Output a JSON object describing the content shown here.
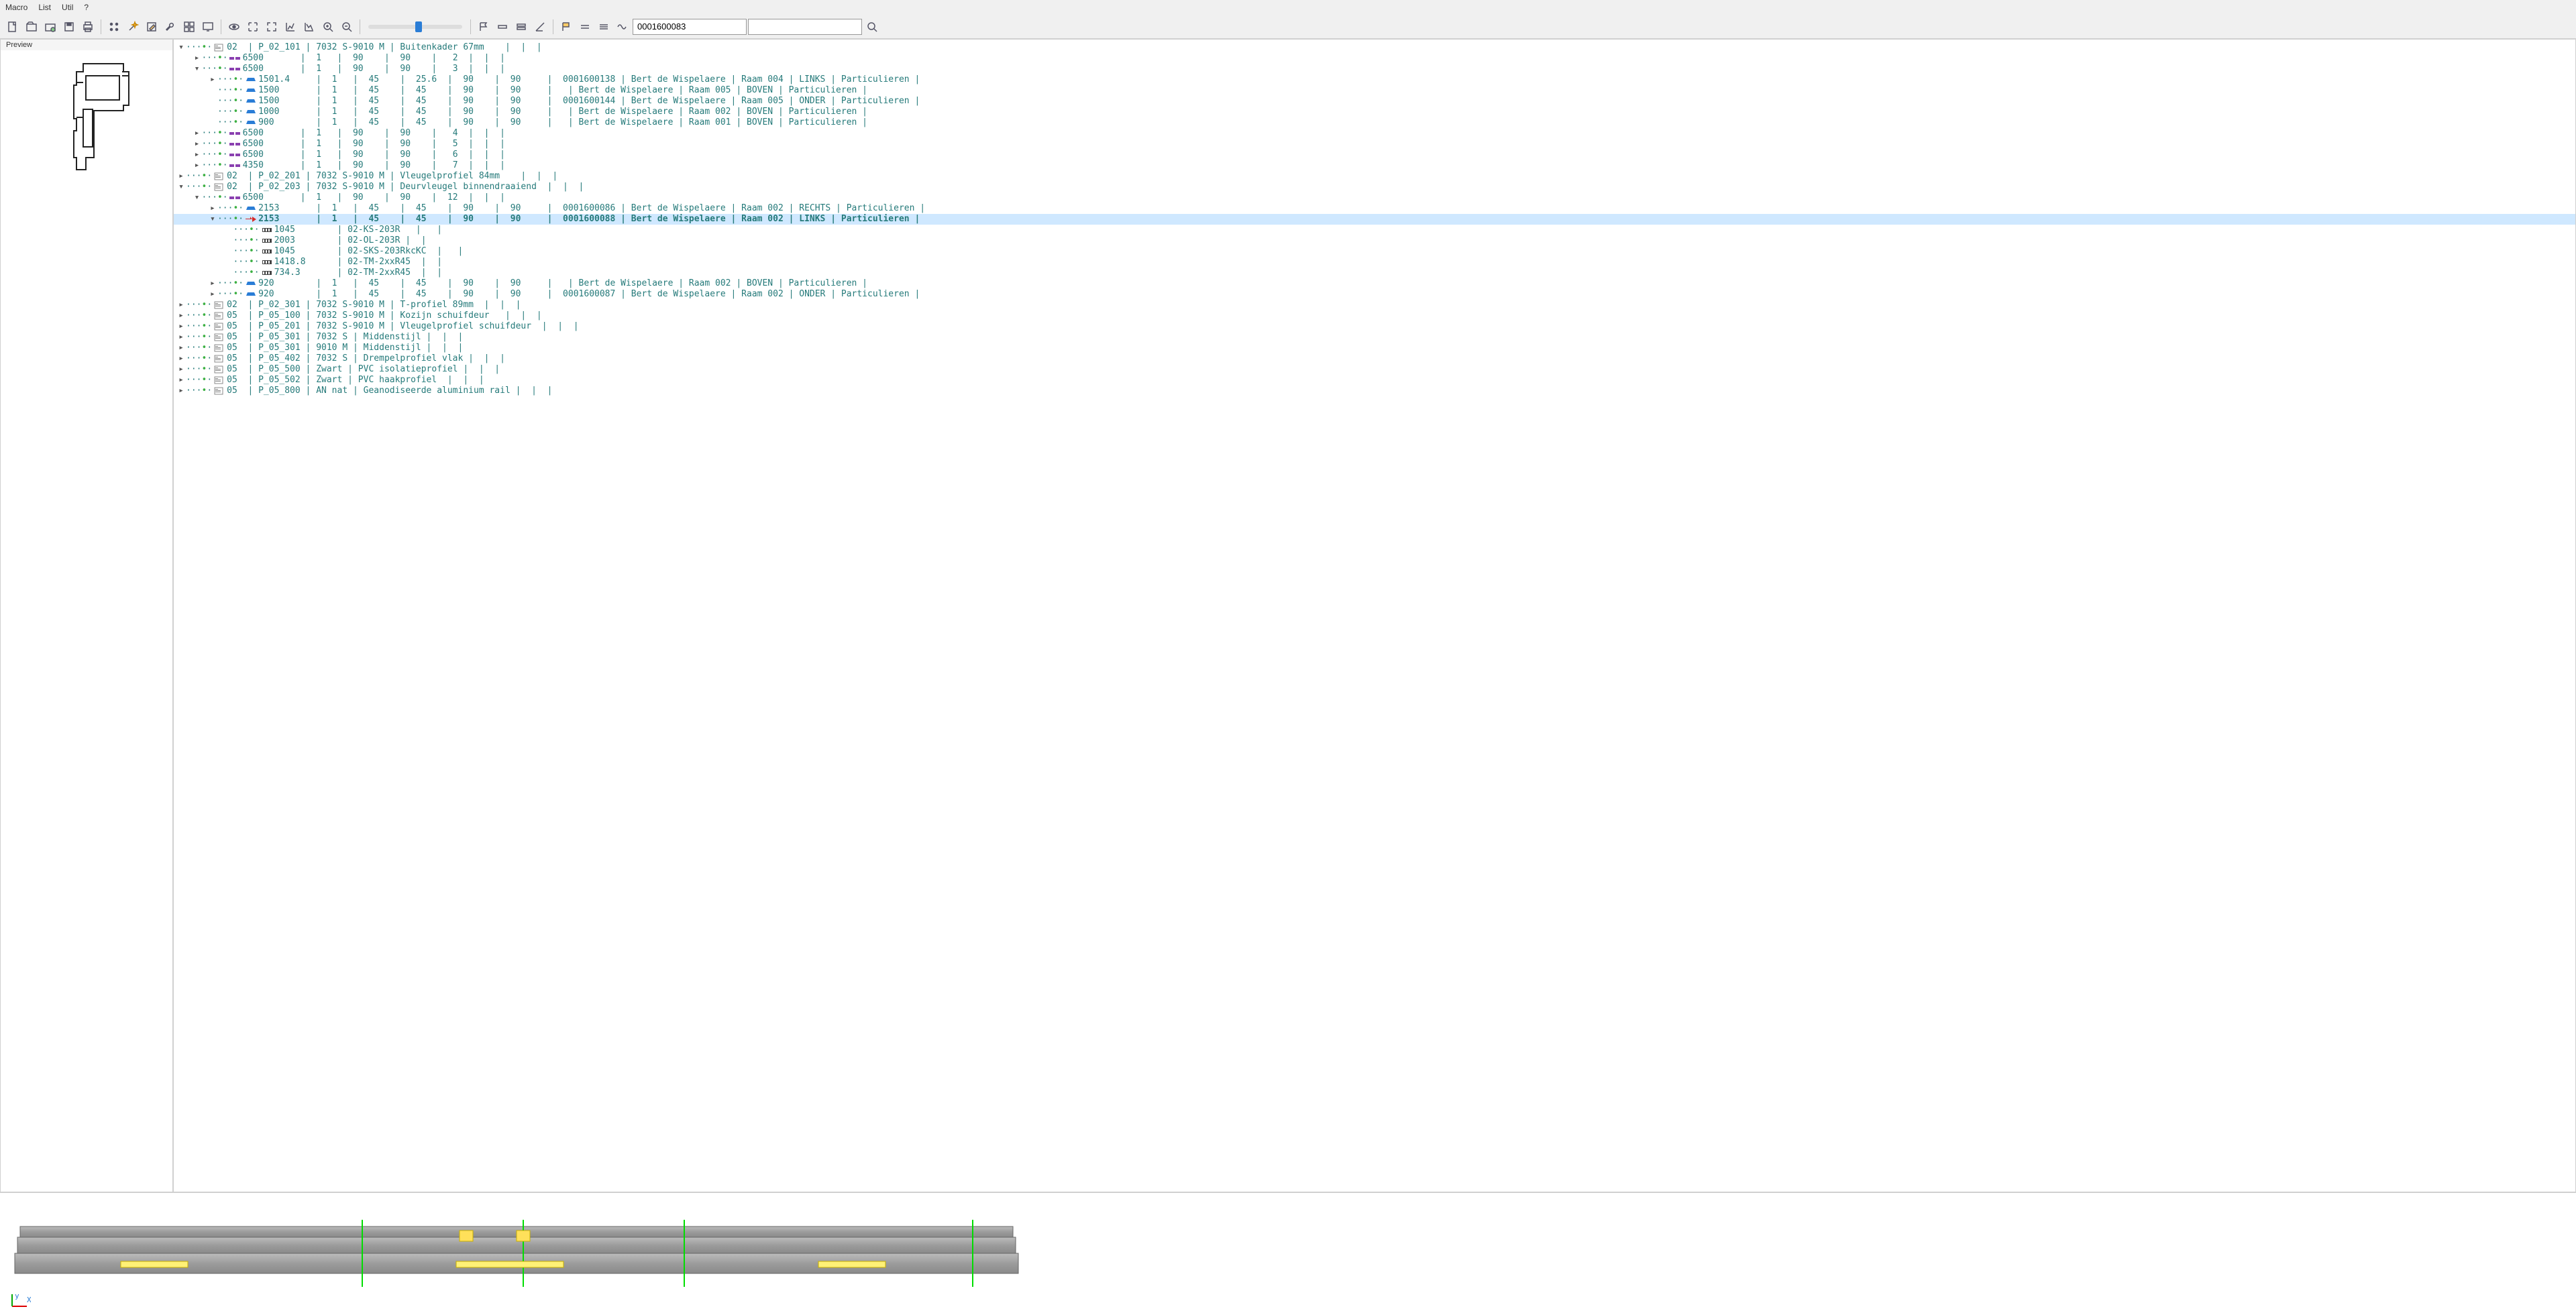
{
  "menu": {
    "items": [
      "Macro",
      "List",
      "Util",
      "?"
    ]
  },
  "toolbar": {
    "icons": [
      "file-new",
      "file-open",
      "file-open-alt",
      "save",
      "print",
      "sep",
      "points",
      "wand",
      "edit",
      "wrench",
      "grid",
      "screen",
      "sep",
      "show",
      "expand",
      "reduce",
      "chart-l",
      "chart-r",
      "zoom-in",
      "zoom-out",
      "sep",
      "slider",
      "sep",
      "flag1",
      "bar1",
      "bar2",
      "angle",
      "sep",
      "flag2",
      "eq1",
      "eq2",
      "wave"
    ],
    "combo_value": "0001600083",
    "search_value": ""
  },
  "preview": {
    "title": "Preview"
  },
  "tree": [
    {
      "d": 0,
      "c": "v",
      "i": "doc",
      "t": "02  | P_02_101 | 7032 S-9010 M | Buitenkader 67mm    |  |  | "
    },
    {
      "d": 1,
      "c": ">",
      "i": "bar",
      "t": "6500       |  1   |  90    |  90    |   2  |  |  | "
    },
    {
      "d": 1,
      "c": "v",
      "i": "bar",
      "t": "6500       |  1   |  90    |  90    |   3  |  |  | "
    },
    {
      "d": 2,
      "c": ">",
      "i": "pc",
      "t": "1501.4     |  1   |  45    |  25.6  |  90    |  90     |  0001600138 | Bert de Wispelaere | Raam 004 | LINKS | Particulieren | "
    },
    {
      "d": 2,
      "c": "",
      "i": "pc",
      "t": "1500       |  1   |  45    |  45    |  90    |  90     |   | Bert de Wispelaere | Raam 005 | BOVEN | Particulieren | "
    },
    {
      "d": 2,
      "c": "",
      "i": "pc",
      "t": "1500       |  1   |  45    |  45    |  90    |  90     |  0001600144 | Bert de Wispelaere | Raam 005 | ONDER | Particulieren | "
    },
    {
      "d": 2,
      "c": "",
      "i": "pc",
      "t": "1000       |  1   |  45    |  45    |  90    |  90     |   | Bert de Wispelaere | Raam 002 | BOVEN | Particulieren | "
    },
    {
      "d": 2,
      "c": "",
      "i": "pc",
      "t": "900        |  1   |  45    |  45    |  90    |  90     |   | Bert de Wispelaere | Raam 001 | BOVEN | Particulieren | "
    },
    {
      "d": 1,
      "c": ">",
      "i": "bar",
      "t": "6500       |  1   |  90    |  90    |   4  |  |  | "
    },
    {
      "d": 1,
      "c": ">",
      "i": "bar",
      "t": "6500       |  1   |  90    |  90    |   5  |  |  | "
    },
    {
      "d": 1,
      "c": ">",
      "i": "bar",
      "t": "6500       |  1   |  90    |  90    |   6  |  |  | "
    },
    {
      "d": 1,
      "c": ">",
      "i": "bar",
      "t": "4350       |  1   |  90    |  90    |   7  |  |  | "
    },
    {
      "d": 0,
      "c": ">",
      "i": "doc",
      "t": "02  | P_02_201 | 7032 S-9010 M | Vleugelprofiel 84mm    |  |  | "
    },
    {
      "d": 0,
      "c": "v",
      "i": "doc",
      "t": "02  | P_02_203 | 7032 S-9010 M | Deurvleugel binnendraaiend  |  |  | "
    },
    {
      "d": 1,
      "c": "v",
      "i": "bar",
      "t": "6500       |  1   |  90    |  90    |  12  |  |  | "
    },
    {
      "d": 2,
      "c": ">",
      "i": "pc",
      "t": "2153       |  1   |  45    |  45    |  90    |  90     |  0001600086 | Bert de Wispelaere | Raam 002 | RECHTS | Particulieren | "
    },
    {
      "d": 2,
      "c": "v",
      "i": "arw",
      "t": "2153       |  1   |  45    |  45    |  90    |  90     |  0001600088 | Bert de Wispelaere | Raam 002 | LINKS | Particulieren | ",
      "sel": true,
      "bold": true
    },
    {
      "d": 3,
      "c": "",
      "i": "op",
      "t": "1045        | 02-KS-203R   |   | "
    },
    {
      "d": 3,
      "c": "",
      "i": "op",
      "t": "2003        | 02-OL-203R |  | "
    },
    {
      "d": 3,
      "c": "",
      "i": "op",
      "t": "1045        | 02-SKS-203RkcKC  |   | "
    },
    {
      "d": 3,
      "c": "",
      "i": "op",
      "t": "1418.8      | 02-TM-2xxR45  |  | "
    },
    {
      "d": 3,
      "c": "",
      "i": "op",
      "t": "734.3       | 02-TM-2xxR45  |  | "
    },
    {
      "d": 2,
      "c": ">",
      "i": "pc",
      "t": "920        |  1   |  45    |  45    |  90    |  90     |   | Bert de Wispelaere | Raam 002 | BOVEN | Particulieren | "
    },
    {
      "d": 2,
      "c": ">",
      "i": "pc",
      "t": "920        |  1   |  45    |  45    |  90    |  90     |  0001600087 | Bert de Wispelaere | Raam 002 | ONDER | Particulieren | "
    },
    {
      "d": 0,
      "c": ">",
      "i": "doc",
      "t": "02  | P_02_301 | 7032 S-9010 M | T-profiel 89mm  |  |  | "
    },
    {
      "d": 0,
      "c": ">",
      "i": "doc",
      "t": "05  | P_05_100 | 7032 S-9010 M | Kozijn schuifdeur   |  |  | "
    },
    {
      "d": 0,
      "c": ">",
      "i": "doc",
      "t": "05  | P_05_201 | 7032 S-9010 M | Vleugelprofiel schuifdeur  |  |  | "
    },
    {
      "d": 0,
      "c": ">",
      "i": "doc",
      "t": "05  | P_05_301 | 7032 S | Middenstijl |  |  | "
    },
    {
      "d": 0,
      "c": ">",
      "i": "doc",
      "t": "05  | P_05_301 | 9010 M | Middenstijl |  |  | "
    },
    {
      "d": 0,
      "c": ">",
      "i": "doc",
      "t": "05  | P_05_402 | 7032 S | Drempelprofiel vlak |  |  | "
    },
    {
      "d": 0,
      "c": ">",
      "i": "doc",
      "t": "05  | P_05_500 | Zwart | PVC isolatieprofiel |  |  | "
    },
    {
      "d": 0,
      "c": ">",
      "i": "doc",
      "t": "05  | P_05_502 | Zwart | PVC haakprofiel  |  |  | "
    },
    {
      "d": 0,
      "c": ">",
      "i": "doc",
      "t": "05  | P_05_800 | AN nat | Geanodiseerde aluminium rail |  |  | "
    }
  ],
  "axis": {
    "x": "X",
    "y": "y"
  }
}
